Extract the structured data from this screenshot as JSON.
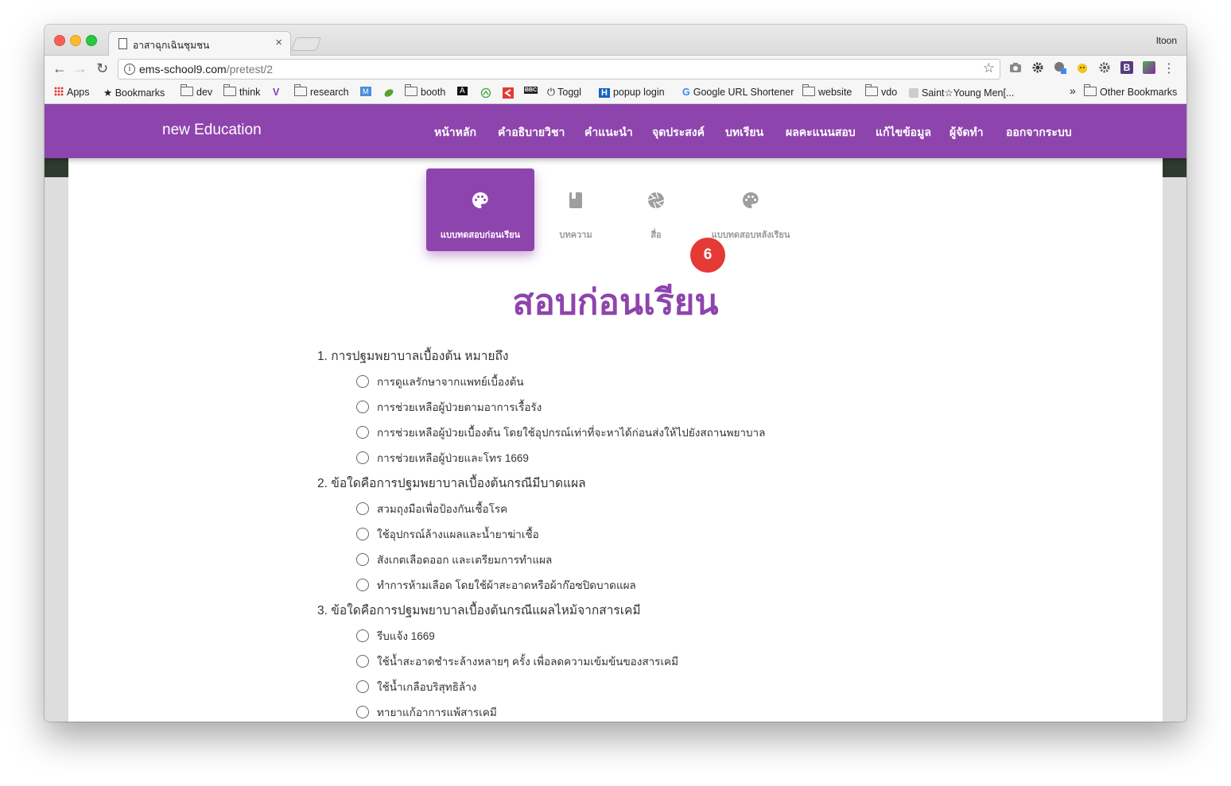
{
  "browser": {
    "tab_title": "อาสาฉุกเฉินชุมชน",
    "tab_close": "×",
    "profile_name": "ltoon",
    "url_host": "ems-school9.com",
    "url_path": "/pretest/2",
    "nav_back": "←",
    "nav_forward": "→",
    "nav_reload": "↻",
    "info_icon": "i",
    "star_icon": "☆",
    "menu_icon": "⋮",
    "extensions": [
      "camera-icon",
      "gear-icon",
      "google-extension-icon",
      "honey-icon",
      "settings-extension-icon",
      "bootstrap-icon",
      "image-extension-icon"
    ],
    "extension_b_label": "B"
  },
  "bookmarks": {
    "apps": "Apps",
    "bookmarks": "Bookmarks",
    "dev": "dev",
    "think": "think",
    "research": "research",
    "booth": "booth",
    "toggl": "Toggl",
    "popup_login": "popup login",
    "google_url_shortener": "Google URL Shortener",
    "website": "website",
    "vdo": "vdo",
    "saint_young": "Saint☆Young Men[...",
    "overflow": "»",
    "other_bookmarks": "Other Bookmarks",
    "icon_a": "A",
    "icon_bbc": "BBC",
    "icon_h": "H",
    "icon_g": "G",
    "icon_m": "M",
    "icon_v": "V"
  },
  "site": {
    "brand": "new Education",
    "nav": [
      "หน้าหลัก",
      "คำอธิบายวิชา",
      "คำแนะนำ",
      "จุดประสงค์",
      "บทเรียน",
      "ผลคะแนนสอบ",
      "แก้ไขข้อมูล",
      "ผู้จัดทำ",
      "ออกจากระบบ"
    ],
    "accent_color": "#8e44ad"
  },
  "pills": [
    {
      "label": "แบบทดสอบก่อนเรียน",
      "icon": "palette-icon",
      "active": true
    },
    {
      "label": "บทความ",
      "icon": "book-icon",
      "active": false
    },
    {
      "label": "สื่อ",
      "icon": "camera-aperture-icon",
      "active": false
    },
    {
      "label": "แบบทดสอบหลังเรียน",
      "icon": "palette-icon",
      "active": false
    }
  ],
  "badge": "6",
  "page_title": "สอบก่อนเรียน",
  "questions": [
    {
      "text": "1. การปฐมพยาบาลเบื้องต้น หมายถึง",
      "choices": [
        "การดูแลรักษาจากแพทย์เบื้องต้น",
        "การช่วยเหลือผู้ป่วยตามอาการเรื้อรัง",
        "การช่วยเหลือผู้ป่วยเบื้องต้น โดยใช้อุปกรณ์เท่าที่จะหาได้ก่อนส่งให้ไปยังสถานพยาบาล",
        "การช่วยเหลือผู้ป่วยและโทร 1669"
      ]
    },
    {
      "text": "2. ข้อใดคือการปฐมพยาบาลเบื้องต้นกรณีมีบาดแผล",
      "choices": [
        "สวมถุงมือเพื่อป้องกันเชื้อโรค",
        "ใช้อุปกรณ์ล้างแผลและน้ำยาฆ่าเชื้อ",
        "สังเกตเลือดออก และเตรียมการทำแผล",
        "ทำการห้ามเลือด โดยใช้ผ้าสะอาดหรือผ้าก๊อซปิดบาดแผล"
      ]
    },
    {
      "text": "3. ข้อใดคือการปฐมพยาบาลเบื้องต้นกรณีแผลไหม้จากสารเคมี",
      "choices": [
        "รีบแจ้ง 1669",
        "ใช้น้ำสะอาดชำระล้างหลายๆ ครั้ง เพื่อลดความเข้มข้นของสารเคมี",
        "ใช้น้ำเกลือบริสุทธิล้าง",
        "ทายาแก้อาการแพ้สารเคมี"
      ]
    }
  ]
}
